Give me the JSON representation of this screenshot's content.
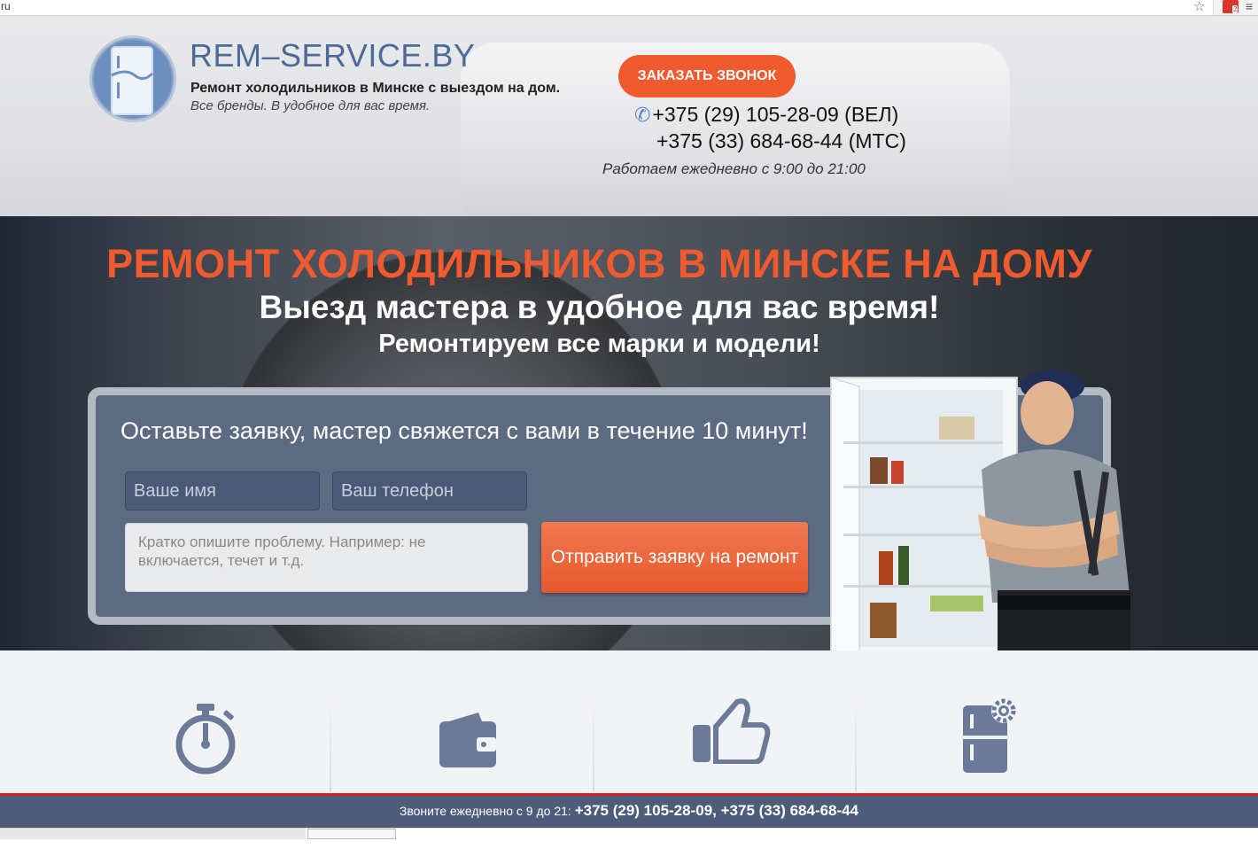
{
  "browser": {
    "url_fragment": "ru",
    "star_icon": "star-icon",
    "extension_badge": "2"
  },
  "header": {
    "brand": "REM–SERVICE.BY",
    "tagline": "Ремонт холодильников в Минске с выездом на дом.",
    "subtagline": "Все бренды. В удобное для вас время.",
    "callback_label": "ЗАКАЗАТЬ ЗВОНОК",
    "phone1": "+375 (29) 105-28-09 (ВЕЛ)",
    "phone2": "+375 (33) 684-68-44 (МТС)",
    "hours": "Работаем ежедневно с 9:00 до 21:00"
  },
  "hero": {
    "title": "РЕМОНТ ХОЛОДИЛЬНИКОВ В МИНСКЕ НА ДОМУ",
    "subtitle": "Выезд мастера в удобное для вас время!",
    "subtitle2": "Ремонтируем все марки и модели!"
  },
  "form": {
    "title": "Оставьте заявку, мастер свяжется с вами в течение 10 минут!",
    "name_placeholder": "Ваше имя",
    "phone_placeholder": "Ваш телефон",
    "message_placeholder": "Кратко опишите проблему. Например: не включается, течет и т.д.",
    "submit_label": "Отправить заявку на ремонт"
  },
  "features": [
    {
      "icon": "stopwatch-icon"
    },
    {
      "icon": "wallet-icon"
    },
    {
      "icon": "thumbs-up-icon"
    },
    {
      "icon": "fridge-gear-icon"
    }
  ],
  "footer": {
    "prefix": "Звоните ежедневно с 9 до 21: ",
    "phones": "+375 (29) 105-28-09, +375 (33) 684-68-44"
  },
  "colors": {
    "accent": "#ef5a2e",
    "brand_blue": "#4a6a99",
    "panel": "#5c6a82",
    "footer": "#4d5c78",
    "footer_line": "#d72020",
    "icon": "#6a7a98"
  }
}
